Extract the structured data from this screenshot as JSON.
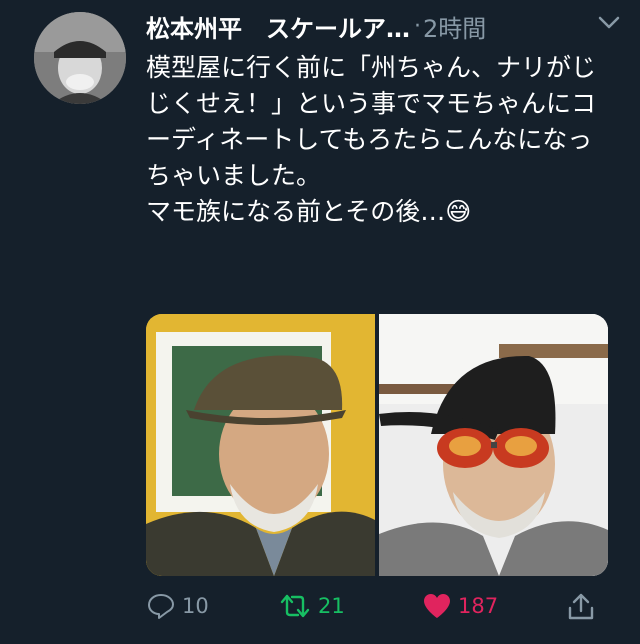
{
  "tweet": {
    "author_name": "松本州平　スケールア…",
    "separator": "·",
    "time": "2時間",
    "text": "模型屋に行く前に「州ちゃん、ナリがじじくせえ！」という事でマモちゃんにコーディネートしてもろたらこんなになっちゃいました。\nマモ族になる前とその後…😅",
    "media_left_desc": "before-photo",
    "media_right_desc": "after-photo"
  },
  "actions": {
    "reply_count": "10",
    "retweet_count": "21",
    "like_count": "187"
  },
  "colors": {
    "background": "#15202b",
    "secondary_text": "#8899a6",
    "retweet_active": "#17bf63",
    "like_active": "#e0245e"
  },
  "icons": [
    "reply-icon",
    "retweet-icon",
    "heart-icon",
    "share-icon",
    "chevron-down-icon"
  ]
}
